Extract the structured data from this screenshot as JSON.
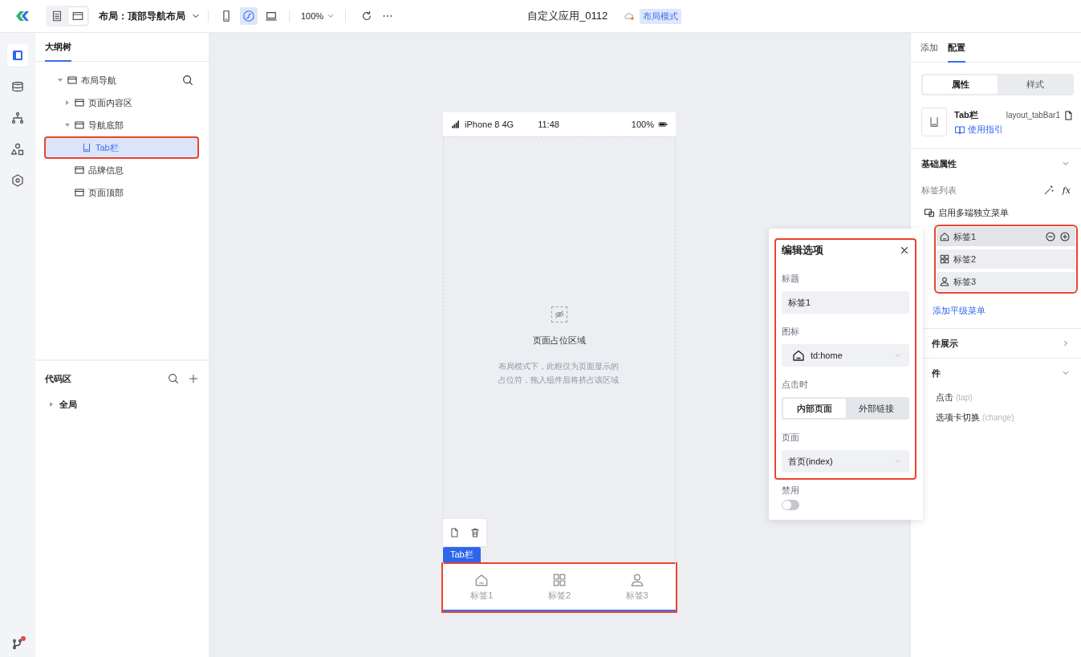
{
  "topbar": {
    "view_toggle": [
      {
        "kind": "doc",
        "selected": false
      },
      {
        "kind": "layout",
        "selected": true
      }
    ],
    "layout_label": "布局：顶部导航布局",
    "devices": [
      {
        "kind": "phone",
        "selected": false
      },
      {
        "kind": "miniapp",
        "selected": true
      },
      {
        "kind": "desktop",
        "selected": false
      }
    ],
    "zoom": "100%",
    "app_title": "自定义应用_0112",
    "mode_badge": "布局模式"
  },
  "rail": {
    "items": [
      {
        "kind": "outline",
        "selected": true
      },
      {
        "kind": "database",
        "selected": false
      },
      {
        "kind": "hierarchy",
        "selected": false
      },
      {
        "kind": "shapes",
        "selected": false
      },
      {
        "kind": "hexagon",
        "selected": false
      }
    ],
    "branch_notification": true
  },
  "outline": {
    "title": "大纲树",
    "tree": [
      {
        "label": "布局导航",
        "kind": "layout",
        "expanded": true,
        "selected": false,
        "children": [
          {
            "label": "页面内容区",
            "kind": "layout",
            "expanded": false,
            "selected": false
          },
          {
            "label": "导航底部",
            "kind": "layout",
            "expanded": true,
            "selected": false,
            "children": [
              {
                "label": "Tab栏",
                "kind": "tabbar",
                "selected": true,
                "highlighted": true
              }
            ]
          },
          {
            "label": "品牌信息",
            "kind": "layout",
            "selected": false
          },
          {
            "label": "页面顶部",
            "kind": "layout",
            "selected": false
          }
        ]
      }
    ]
  },
  "code_area": {
    "title": "代码区",
    "items": [
      {
        "label": "全局",
        "expanded": false
      }
    ]
  },
  "phone": {
    "status_bar": {
      "device": "iPhone 8  4G",
      "time": "11:48",
      "battery": "100%"
    },
    "placeholder_title": "页面占位区域",
    "placeholder_text": "布局模式下，此框仅为页面显示的占位符，拖入组件后将挤占该区域",
    "selection_label": "Tab栏",
    "tab_bar": {
      "highlighted": true,
      "items": [
        {
          "label": "标签1",
          "kind": "home"
        },
        {
          "label": "标签2",
          "kind": "grid"
        },
        {
          "label": "标签3",
          "kind": "user"
        }
      ]
    }
  },
  "right_panel": {
    "tabs": [
      {
        "label": "添加",
        "selected": false
      },
      {
        "label": "配置",
        "selected": true
      }
    ],
    "segments": [
      {
        "label": "属性",
        "selected": true
      },
      {
        "label": "样式",
        "selected": false
      }
    ],
    "component": {
      "name": "Tab栏",
      "id": "layout_tabBar1",
      "guide_link": "使用指引"
    },
    "basic": {
      "title": "基础属性",
      "expanded": true,
      "list_label": "标签列表",
      "fx": "fx",
      "multi_menu_label": "启用多端独立菜单",
      "tabs": {
        "highlighted": true,
        "items": [
          {
            "label": "标签1",
            "kind": "home",
            "selected": true
          },
          {
            "label": "标签2",
            "kind": "grid",
            "selected": false
          },
          {
            "label": "标签3",
            "kind": "user",
            "selected": false
          }
        ]
      },
      "add_link": "添加平级菜单"
    },
    "sections": [
      {
        "title": "件展示",
        "expanded": false
      },
      {
        "title": "件",
        "expanded": true,
        "events": [
          {
            "name": "点击",
            "event": "(tap)"
          },
          {
            "name": "选项卡切换",
            "event": "(change)"
          }
        ]
      }
    ]
  },
  "edit_popup": {
    "title": "编辑选项",
    "highlighted": true,
    "title_label": "标题",
    "title_value": "标签1",
    "icon_label": "图标",
    "icon_value": {
      "kind": "home",
      "text": "td:home"
    },
    "click_label": "点击时",
    "click_options": [
      {
        "label": "内部页面",
        "selected": true
      },
      {
        "label": "外部链接",
        "selected": false
      }
    ],
    "page_label": "页面",
    "page_value": "首页(index)",
    "disabled_label": "禁用",
    "disabled": false
  }
}
